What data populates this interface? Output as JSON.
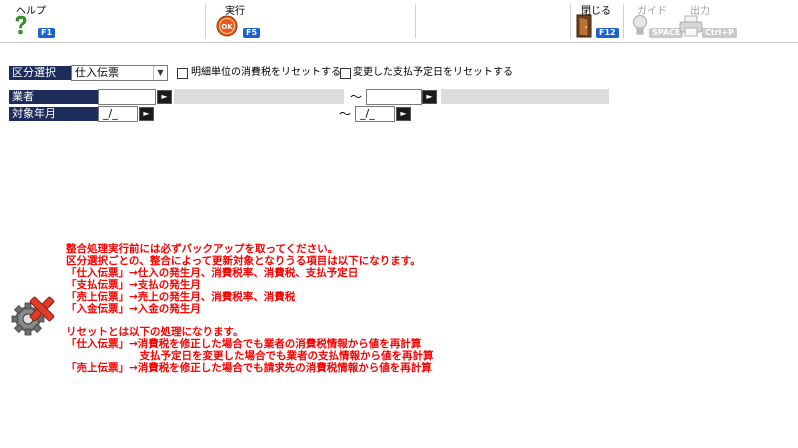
{
  "toolbar": {
    "help": {
      "label": "ヘルプ",
      "key": "F1"
    },
    "execute": {
      "label": "実行",
      "key": "F5"
    },
    "close": {
      "label": "閉じる",
      "key": "F12"
    },
    "guide": {
      "label": "ガイド",
      "key": "SPACE"
    },
    "output": {
      "label": "出力",
      "key": "Ctrl+P"
    }
  },
  "form": {
    "category_label": "区分選択",
    "category_value": "仕入伝票",
    "reset_tax_label": "明細単位の消費税をリセットする",
    "reset_tax_checked": false,
    "reset_pay_date_label": "変更した支払予定日をリセットする",
    "reset_pay_date_checked": false,
    "vendor_label": "業者",
    "vendor_from": "",
    "vendor_to": "",
    "period_label": "対象年月",
    "period_from": "_/_",
    "period_to": "_/_",
    "range_sep": "～"
  },
  "message": {
    "lines": [
      "整合処理実行前には必ずバックアップを取ってください。",
      "区分選択ごとの、整合によって更新対象となりうる項目は以下になります。",
      "「仕入伝票」→仕入の発生月、消費税率、消費税、支払予定日",
      "「支払伝票」→支払の発生月",
      "「売上伝票」→売上の発生月、消費税率、消費税",
      "「入金伝票」→入金の発生月",
      "",
      "リセットとは以下の処理になります。",
      "「仕入伝票」→消費税を修正した場合でも業者の消費税情報から値を再計算",
      "　　　　　　　支払予定日を変更した場合でも業者の支払情報から値を再計算",
      "「売上伝票」→消費税を修正した場合でも請求先の消費税情報から値を再計算"
    ]
  },
  "colors": {
    "label_bg": "#1e2c5c",
    "message": "#ff0000",
    "key_badge": "#1a62d0",
    "readonly": "#dcdcdc"
  },
  "icons": {
    "help": "question-icon",
    "execute": "ok-icon",
    "close": "door-icon",
    "guide": "lightbulb-icon",
    "output": "printer-icon",
    "warning": "gear-x-icon"
  }
}
